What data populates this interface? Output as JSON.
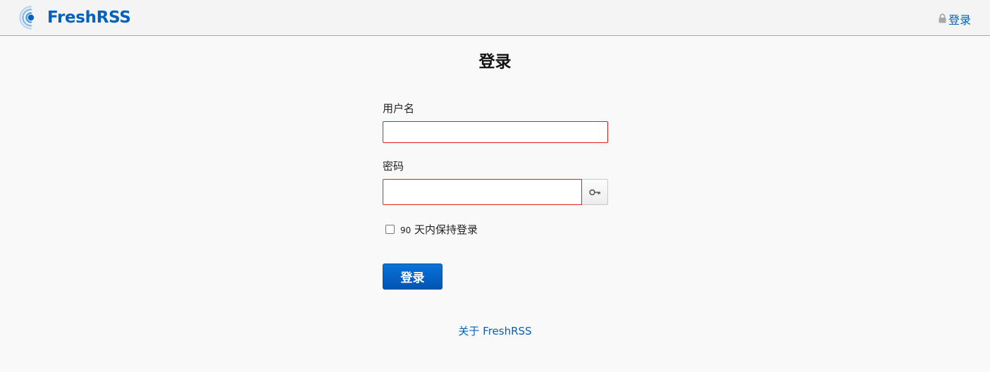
{
  "header": {
    "logo_text": "FreshRSS",
    "login_label": "登录",
    "brand_color": "#0062be"
  },
  "page": {
    "title": "登录"
  },
  "form": {
    "username_label": "用户名",
    "username_value": "",
    "password_label": "密码",
    "password_value": "",
    "remember_number": "90",
    "remember_text": " 天内保持登录",
    "remember_checked": false,
    "submit_label": "登录",
    "invalid_border_color": "#e41d1d"
  },
  "footer": {
    "about_link": "关于 FreshRSS"
  },
  "icons": {
    "logo": "rss-signal-icon",
    "login": "lock-icon",
    "reveal": "key-icon"
  }
}
